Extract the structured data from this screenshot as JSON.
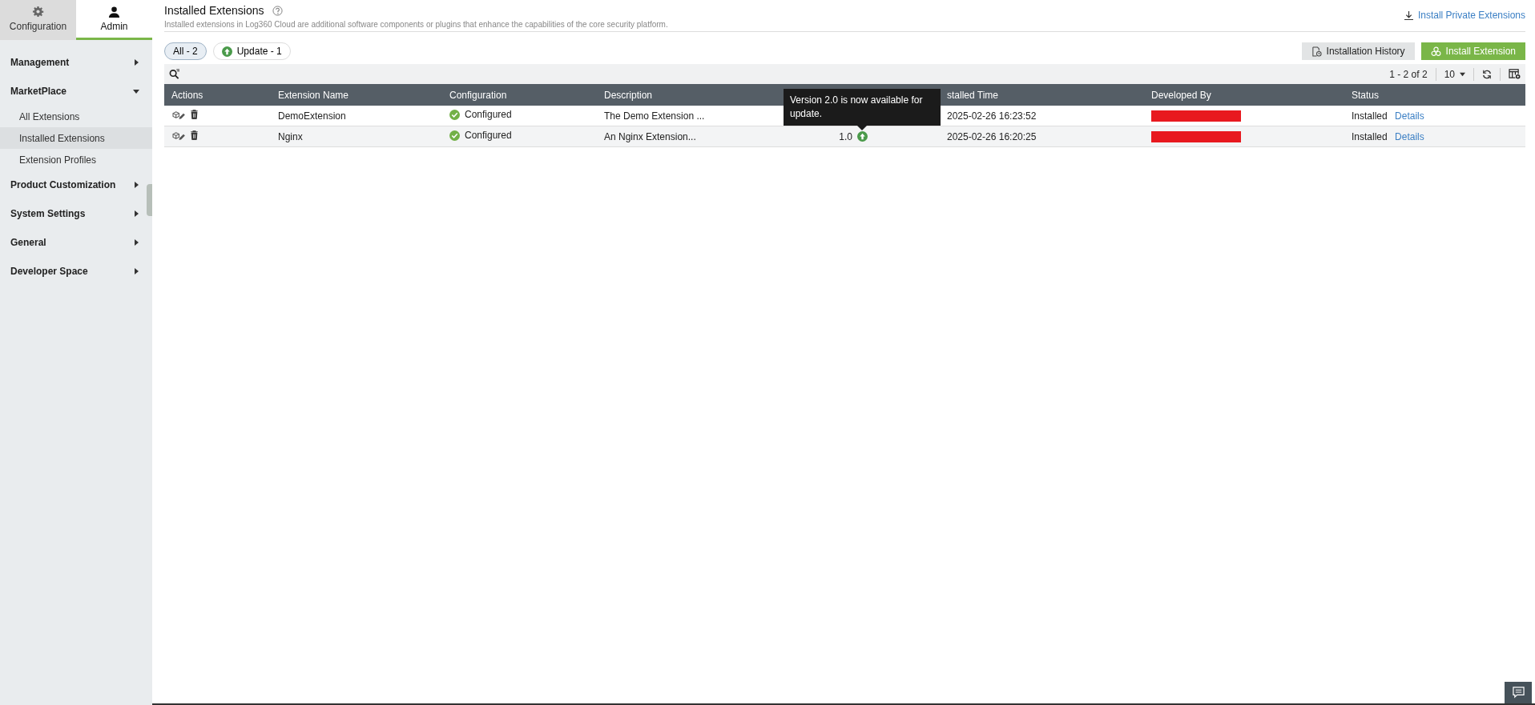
{
  "sidebar": {
    "tabs": [
      {
        "label": "Configuration",
        "selected": false
      },
      {
        "label": "Admin",
        "selected": true
      }
    ],
    "menu": [
      {
        "label": "Management",
        "expanded": false
      },
      {
        "label": "MarketPlace",
        "expanded": true,
        "children": [
          {
            "label": "All Extensions",
            "selected": false
          },
          {
            "label": "Installed Extensions",
            "selected": true
          },
          {
            "label": "Extension Profiles",
            "selected": false
          }
        ]
      },
      {
        "label": "Product Customization",
        "expanded": false
      },
      {
        "label": "System Settings",
        "expanded": false
      },
      {
        "label": "General",
        "expanded": false
      },
      {
        "label": "Developer Space",
        "expanded": false
      }
    ]
  },
  "header": {
    "title": "Installed Extensions",
    "description": "Installed extensions in Log360 Cloud are additional software components or plugins that enhance the capabilities of the core security platform.",
    "link": "Install Private Extensions"
  },
  "filters": [
    {
      "label": "All - 2",
      "kind": "plain",
      "selected": true
    },
    {
      "label": "Update - 1",
      "kind": "update",
      "selected": false
    }
  ],
  "buttons": [
    {
      "label": "Installation History",
      "kind": "secondary"
    },
    {
      "label": "Install Extension",
      "kind": "primary"
    }
  ],
  "pager": {
    "range": "1 - 2 of 2",
    "page_size": "10"
  },
  "table": {
    "columns": [
      {
        "label": "Actions"
      },
      {
        "label": "Extension Name"
      },
      {
        "label": "Configuration"
      },
      {
        "label": "Description"
      },
      {},
      {
        "label": "stalled Time"
      },
      {
        "label": "Developed By"
      },
      {
        "label": "Status"
      }
    ],
    "rows": [
      {
        "name": "DemoExtension",
        "configuration": "Configured",
        "description": "The Demo Extension ...",
        "installed_time": "2025-02-26 16:23:52",
        "developer_redacted": true,
        "status": "Installed",
        "details": "Details"
      },
      {
        "name": "Nginx",
        "configuration": "Configured",
        "description": "An Nginx Extension...",
        "version": "1.0",
        "update_available": true,
        "installed_time": "2025-02-26 16:20:25",
        "developer_redacted": true,
        "status": "Installed",
        "details": "Details"
      }
    ]
  },
  "tooltip": {
    "text": "Version 2.0 is now available for update."
  }
}
